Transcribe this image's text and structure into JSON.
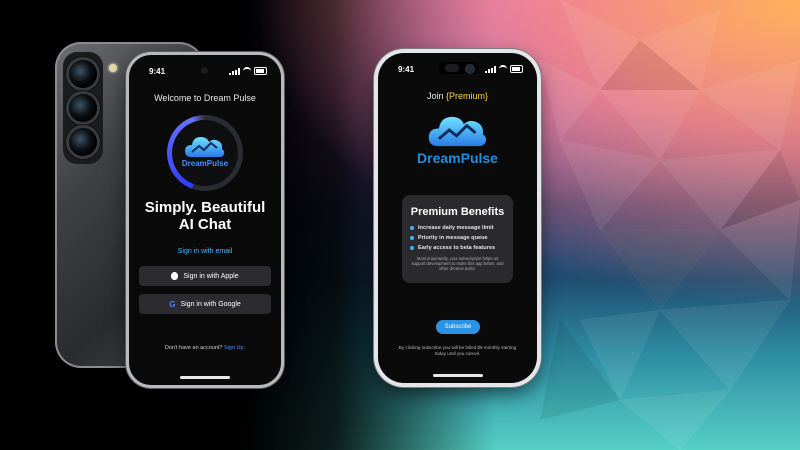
{
  "background": {
    "left_color": "#000000",
    "accent_warm": "#ffb15a",
    "accent_cool": "#54d0c4"
  },
  "phone1": {
    "status_time": "9:41",
    "welcome": "Welcome to Dream Pulse",
    "brand": "DreamPulse",
    "headline_line1": "Simply. Beautiful",
    "headline_line2": "AI Chat",
    "email_link": "Sign in with email",
    "apple_button": "Sign in with Apple",
    "google_button": "Sign in with Google",
    "google_icon": "G",
    "no_account": "Don't have an account?",
    "signup_link": "Sign Up."
  },
  "phone2": {
    "status_time": "9:41",
    "join_prefix": "Join",
    "join_highlight": "{Premium}",
    "brand": "DreamPulse",
    "card_title": "Premium Benefits",
    "benefits": [
      "Increase daily message limit",
      "Priority in message queue",
      "Early access to beta features"
    ],
    "card_note": "Most importantly, your subscription helps us support development to make this app better, and other dreams pulse.",
    "subscribe_button": "Subscribe",
    "billing_line1": "By clicking subscribe you will be billed $9 monthly starting",
    "billing_line2": "today until you cancel."
  },
  "colors": {
    "brand_blue": "#1f8fe0",
    "link_blue": "#4bb6ff",
    "premium_yellow": "#ffd24a",
    "card_bg": "#2b2b2f"
  }
}
